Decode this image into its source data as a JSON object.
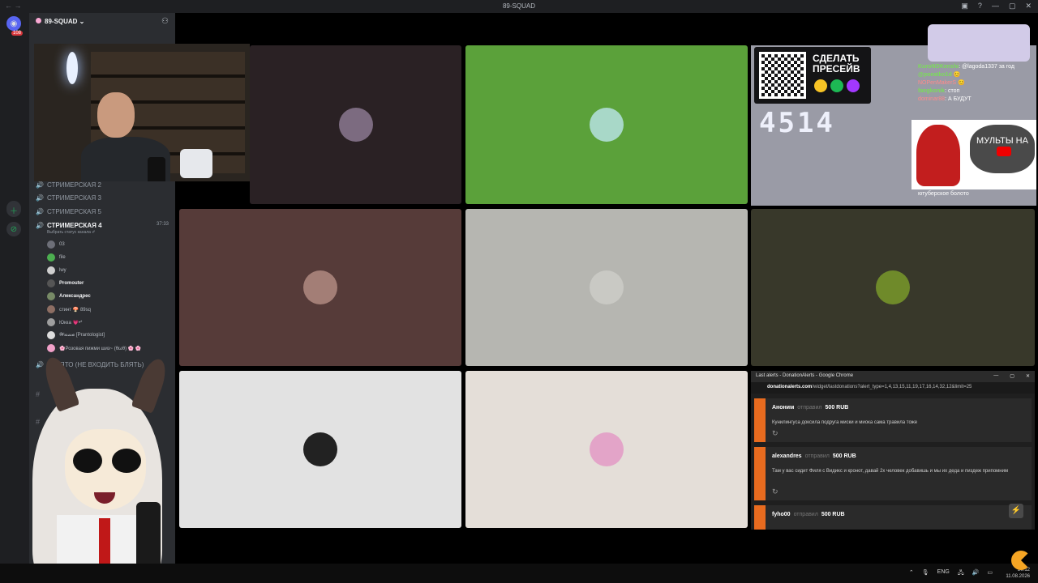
{
  "window": {
    "title": "89-SQUAD",
    "controls": [
      "▣",
      "?",
      "—",
      "▢",
      "✕"
    ]
  },
  "server": {
    "name": "89-SQUAD ⌄",
    "unread_badge": "108"
  },
  "voice_channels": [
    {
      "name": "СТРИМЕРСКАЯ 2"
    },
    {
      "name": "СТРИМЕРСКАЯ 3"
    },
    {
      "name": "СТРИМЕРСКАЯ 5"
    },
    {
      "name": "СТРИМЕРСКАЯ 4",
      "time": "37:33",
      "status": "Выбрать статус канала ✐"
    },
    {
      "name": "ЗАНЯТО (НЕ ВХОДИТЬ БЛЯТЬ)"
    }
  ],
  "members": [
    {
      "name": "03"
    },
    {
      "name": "file"
    },
    {
      "name": "lwy"
    },
    {
      "name": "Promouter"
    },
    {
      "name": "Александрес"
    },
    {
      "name": "стинт 🍄 89sq"
    },
    {
      "name": "Юкка 💗•*"
    },
    {
      "name": "𝓦𝓲𝓼𝓼𝓼𝓪 [Prantologist]"
    },
    {
      "name": "🌸Розовая пижми шиз~ (θωθ) 🌸 🌸"
    }
  ],
  "stream_overlay": {
    "presave": "СДЕЛАТЬ ПРЕСЕЙВ",
    "counter": "4514",
    "chat": [
      {
        "user": "KuroNOKenshi",
        "text": ": @lagoda1337 за год"
      },
      {
        "user": "@poeatko1d",
        "text": " 😊"
      },
      {
        "user": "NOPenMakerS",
        "text": " 😊"
      },
      {
        "user": "fangkonik",
        "text": ": стоп"
      },
      {
        "user": "dominar88",
        "text": ": А БУДУТ"
      }
    ],
    "banner": "МУЛЬТЫ НА",
    "caption": "ютуберское болото",
    "colors": {
      "qr_bg": "#141416",
      "spotify": "#1db954",
      "deezer": "#a238ff",
      "sun": "#f7c325"
    }
  },
  "donation_window": {
    "title": "Last alerts - DonationAlerts - Google Chrome",
    "url_domain": "donationalerts.com",
    "url_path": "/widget/lastdonations?alert_type=1,4,13,15,11,19,17,16,14,32,12&limit=25",
    "sent_word": "отправил",
    "alerts": [
      {
        "user": "Аноним",
        "amount": "500 RUB",
        "message": "Кунилингуса доксила подруга миски и миока сама травила тоже"
      },
      {
        "user": "alexandres",
        "amount": "500 RUB",
        "message": "Там у вас сидит Филя с Видикс и кронот, давай 2х человек добавишь и мы их деда и пиздеж припомним"
      },
      {
        "user": "fyho00",
        "amount": "500 RUB",
        "message": ""
      }
    ]
  },
  "tiles": [
    {
      "bg": "#2a2124",
      "avatar": "#7c6b80"
    },
    {
      "bg": "#5ba13a",
      "avatar": "#a8d8c8"
    },
    {
      "bg": "#563b39",
      "avatar": "#a37e76"
    },
    {
      "bg": "#b6b6b1",
      "avatar": "#c9c9c4"
    },
    {
      "bg": "#38382a",
      "avatar": "#6f8a2a"
    },
    {
      "bg": "#e2e2e2",
      "avatar": "#222222"
    },
    {
      "bg": "#e4ded8",
      "avatar": "#e3a4c8"
    }
  ],
  "taskbar": {
    "lang": "ENG",
    "time": "20:12",
    "date": "11.08.2026"
  }
}
